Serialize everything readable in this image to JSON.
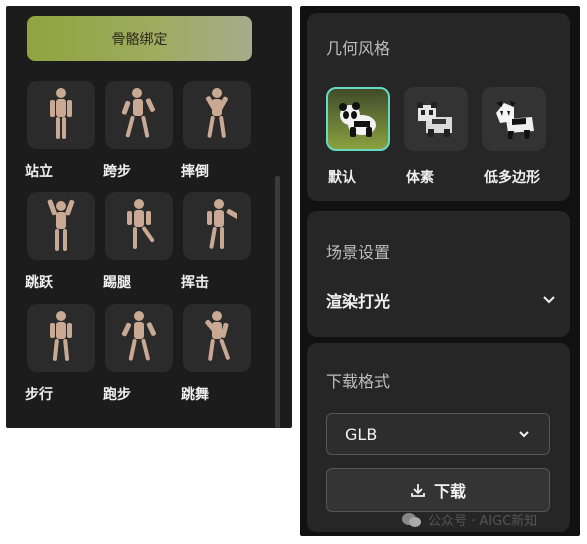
{
  "rig_button": "骨骼绑定",
  "animations": [
    {
      "label": "站立"
    },
    {
      "label": "跨步"
    },
    {
      "label": "摔倒"
    },
    {
      "label": "跳跃"
    },
    {
      "label": "踢腿"
    },
    {
      "label": "挥击"
    },
    {
      "label": "步行"
    },
    {
      "label": "跑步"
    },
    {
      "label": "跳舞"
    }
  ],
  "geometry_style": {
    "title": "几何风格",
    "options": [
      {
        "label": "默认",
        "selected": true
      },
      {
        "label": "体素"
      },
      {
        "label": "低多边形"
      }
    ]
  },
  "scene_settings": {
    "title": "场景设置",
    "selected": "渲染打光"
  },
  "download": {
    "title": "下载格式",
    "format": "GLB",
    "button": "下载"
  },
  "watermark": "公众号 · AIGC新知"
}
